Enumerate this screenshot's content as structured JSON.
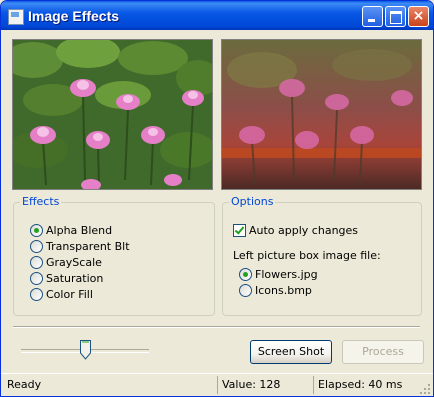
{
  "window": {
    "title": "Image Effects",
    "close_glyph": "×"
  },
  "effects": {
    "legend": "Effects",
    "items": [
      {
        "label": "Alpha Blend",
        "selected": true
      },
      {
        "label": "Transparent Blt",
        "selected": false
      },
      {
        "label": "GrayScale",
        "selected": false
      },
      {
        "label": "Saturation",
        "selected": false
      },
      {
        "label": "Color Fill",
        "selected": false
      }
    ]
  },
  "options": {
    "legend": "Options",
    "auto_apply": {
      "label": "Auto apply changes",
      "checked": true
    },
    "file_label": "Left picture box image file:",
    "files": [
      {
        "label": "Flowers.jpg",
        "selected": true
      },
      {
        "label": "Icons.bmp",
        "selected": false
      }
    ]
  },
  "slider": {
    "value": 128,
    "max": 255
  },
  "buttons": {
    "screen_shot": "Screen Shot",
    "process": "Process"
  },
  "status": {
    "ready": "Ready",
    "value": "Value: 128",
    "elapsed": "Elapsed: 40 ms"
  },
  "icons": {
    "window_icon": "app-window-icon",
    "minimize": "minimize-icon",
    "maximize": "maximize-icon",
    "close": "close-icon"
  }
}
